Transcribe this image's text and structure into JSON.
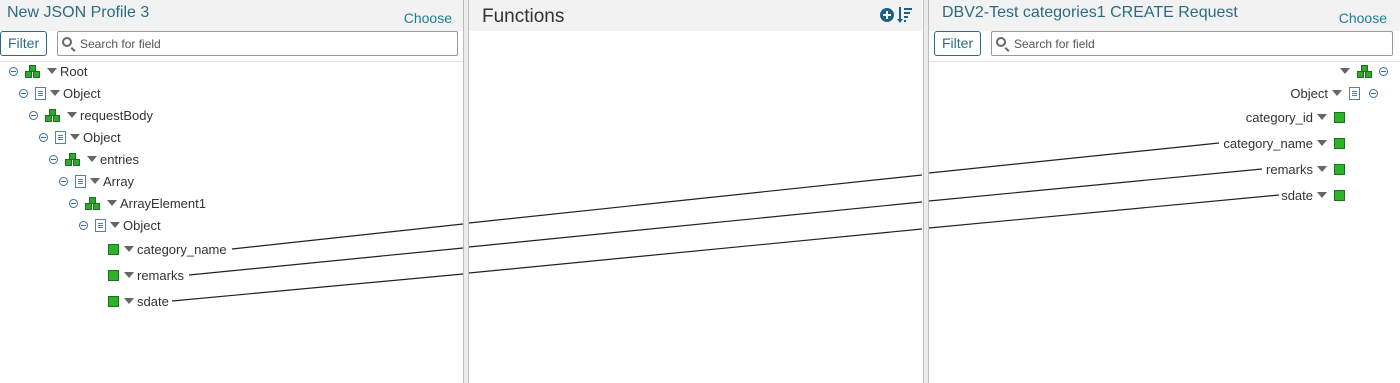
{
  "left": {
    "title": "New JSON Profile 3",
    "choose": "Choose",
    "filter": "Filter",
    "search_placeholder": "Search for field",
    "nodes": [
      {
        "label": "Root"
      },
      {
        "label": "Object"
      },
      {
        "label": "requestBody"
      },
      {
        "label": "Object"
      },
      {
        "label": "entries"
      },
      {
        "label": "Array"
      },
      {
        "label": "ArrayElement1"
      },
      {
        "label": "Object"
      },
      {
        "label": "category_name"
      },
      {
        "label": "remarks"
      },
      {
        "label": "sdate"
      }
    ]
  },
  "middle": {
    "title": "Functions"
  },
  "right": {
    "title": "DBV2-Test categories1 CREATE Request",
    "choose": "Choose",
    "filter": "Filter",
    "search_placeholder": "Search for field",
    "nodes": [
      {
        "label": "Object"
      },
      {
        "label": "category_id"
      },
      {
        "label": "category_name"
      },
      {
        "label": "remarks"
      },
      {
        "label": "sdate"
      }
    ]
  },
  "mappings": [
    {
      "from": "category_name",
      "to": "category_name"
    },
    {
      "from": "remarks",
      "to": "remarks"
    },
    {
      "from": "sdate",
      "to": "sdate"
    }
  ],
  "icons": {
    "collapse": "collapse-icon",
    "group": "group-icon",
    "object": "object-icon",
    "field": "field-icon",
    "dropdown": "dropdown-arrow-icon",
    "search": "search-icon",
    "add_function": "add-function-icon",
    "sort": "sort-icon"
  },
  "colors": {
    "title": "#2b6c82",
    "link": "#1e7d96",
    "field_green": "#2fb12a",
    "header_bg": "#f2f2f2"
  }
}
